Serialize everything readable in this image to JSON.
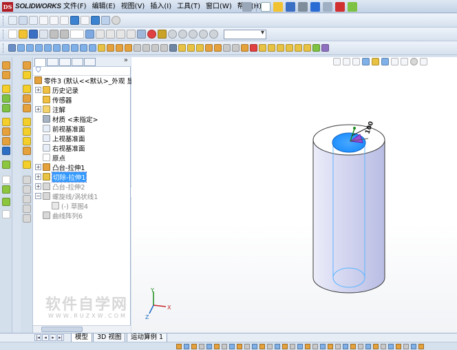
{
  "app": {
    "logo_text": "SOLIDWORKS",
    "brand_color": "#b01c23"
  },
  "menu": {
    "items": [
      "文件(F)",
      "编辑(E)",
      "视图(V)",
      "插入(I)",
      "工具(T)",
      "窗口(W)",
      "帮助(H)"
    ]
  },
  "feature_tree": {
    "root": "零件3  (默认<<默认>_外观 显",
    "items": [
      {
        "label": "历史记录",
        "icon": "history-icon",
        "expandable": true
      },
      {
        "label": "传感器",
        "icon": "sensor-icon",
        "expandable": false
      },
      {
        "label": "注解",
        "icon": "annotation-icon",
        "expandable": true
      },
      {
        "label": "材质 <未指定>",
        "icon": "material-icon",
        "expandable": false
      },
      {
        "label": "前视基准面",
        "icon": "plane-icon",
        "expandable": false
      },
      {
        "label": "上视基准面",
        "icon": "plane-icon",
        "expandable": false
      },
      {
        "label": "右视基准面",
        "icon": "plane-icon",
        "expandable": false
      },
      {
        "label": "原点",
        "icon": "origin-icon",
        "expandable": false
      },
      {
        "label": "凸台-拉伸1",
        "icon": "extrude-boss-icon",
        "expandable": true
      },
      {
        "label": "切除-拉伸1",
        "icon": "extrude-cut-icon",
        "expandable": true,
        "selected": true
      },
      {
        "label": "凸台-拉伸2",
        "icon": "extrude-boss-icon",
        "expandable": true,
        "suppressed": true
      },
      {
        "label": "螺旋线/涡状线1",
        "icon": "helix-icon",
        "expandable": true,
        "suppressed": true
      },
      {
        "label": "(-) 草图4",
        "icon": "sketch-icon",
        "expandable": false,
        "suppressed": true,
        "child": true
      },
      {
        "label": "曲线阵列6",
        "icon": "curve-pattern-icon",
        "expandable": false,
        "suppressed": true
      }
    ]
  },
  "viewport": {
    "dimension_label": "100",
    "axis_labels": {
      "x": "X",
      "y": "Y",
      "z": "Z"
    },
    "cylinder_color": "#cfd1ef",
    "hole_color": "#1e90ff"
  },
  "bottom_tabs": [
    "模型",
    "3D 视图",
    "运动算例 1"
  ],
  "watermark": {
    "main": "软件自学网",
    "sub": "WWW.RUZXW.COM"
  }
}
